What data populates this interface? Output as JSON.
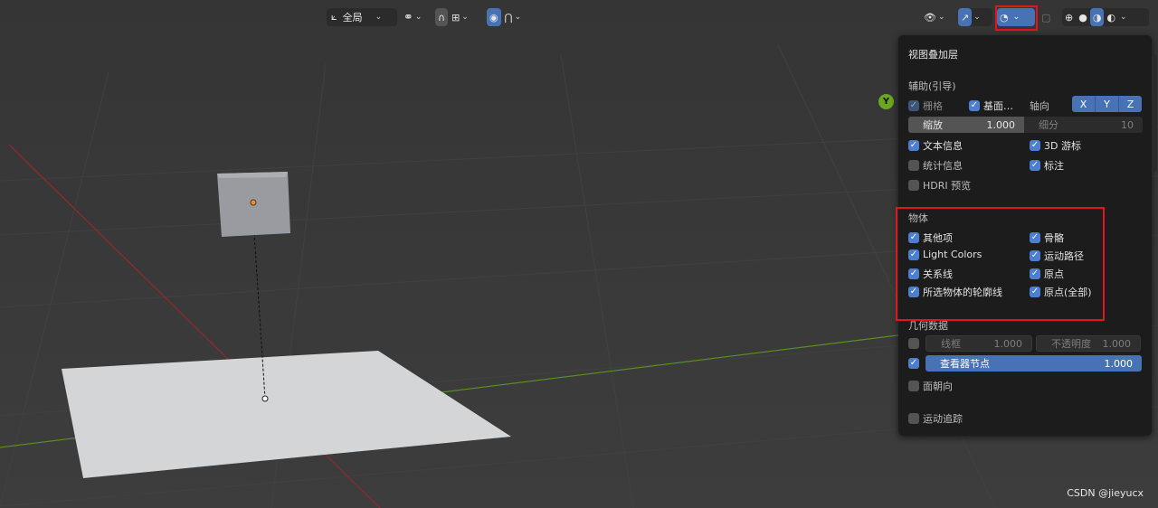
{
  "header": {
    "transform_space": "全局"
  },
  "overlay_panel": {
    "title": "视图叠加层",
    "guides": {
      "section": "辅助(引导)",
      "grid": {
        "label": "栅格",
        "checked": true
      },
      "floor": {
        "label": "基面…",
        "checked": true
      },
      "axes_label": "轴向",
      "axes": [
        "X",
        "Y",
        "Z"
      ],
      "scale": {
        "label": "缩放",
        "value": "1.000"
      },
      "subdivisions": {
        "label": "细分",
        "value": "10"
      },
      "text_info": {
        "label": "文本信息",
        "checked": true
      },
      "cursor_3d": {
        "label": "3D 游标",
        "checked": true
      },
      "statistics": {
        "label": "统计信息",
        "checked": false
      },
      "annotations": {
        "label": "标注",
        "checked": true
      },
      "hdri_preview": {
        "label": "HDRI 预览",
        "checked": false
      }
    },
    "objects": {
      "section": "物体",
      "extras": {
        "label": "其他项",
        "checked": true
      },
      "bones": {
        "label": "骨骼",
        "checked": true
      },
      "light_colors": {
        "label": "Light Colors",
        "checked": true
      },
      "motion_paths": {
        "label": "运动路径",
        "checked": true
      },
      "relationship_lines": {
        "label": "关系线",
        "checked": true
      },
      "origins": {
        "label": "原点",
        "checked": true
      },
      "outline_selected": {
        "label": "所选物体的轮廓线",
        "checked": true
      },
      "origins_all": {
        "label": "原点(全部)",
        "checked": true
      }
    },
    "geometry": {
      "section": "几何数据",
      "wireframe": {
        "label": "线框",
        "value": "1.000",
        "checked": false
      },
      "opacity": {
        "label": "不透明度",
        "value": "1.000"
      },
      "viewer_node": {
        "label": "查看器节点",
        "value": "1.000",
        "checked": true
      },
      "face_orientation": {
        "label": "面朝向",
        "checked": false
      }
    },
    "motion_tracking": {
      "label": "运动追踪",
      "checked": false
    }
  },
  "gizmo": {
    "y_axis": "Y"
  },
  "watermark": "CSDN @jieyucx",
  "colors": {
    "accent": "#4772b3",
    "highlight_box": "#e0161e",
    "x_axis": "#8b2a2e",
    "y_axis": "#5a8a20"
  }
}
